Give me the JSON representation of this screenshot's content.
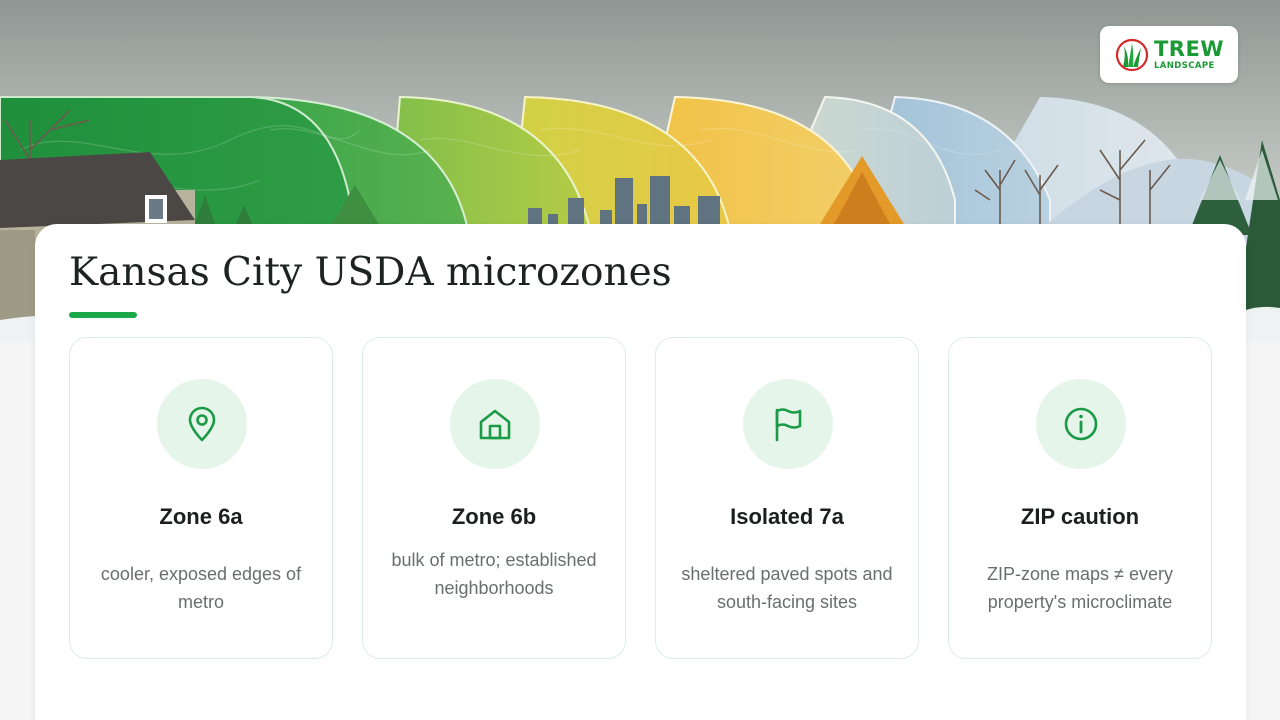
{
  "brand": {
    "name": "TREW",
    "tagline": "LANDSCAPE",
    "color": "#1a9a35"
  },
  "page": {
    "title": "Kansas City USDA microzones",
    "accent": "#1aa84a"
  },
  "zones": [
    {
      "name": "Zone 6a",
      "desc": "cooler, exposed edges of metro",
      "icon": "map-pin-icon"
    },
    {
      "name": "Zone 6b",
      "desc": "bulk of metro; established neighborhoods",
      "icon": "house-icon"
    },
    {
      "name": "Isolated 7a",
      "desc": "sheltered paved spots and south-facing sites",
      "icon": "flag-icon"
    },
    {
      "name": "ZIP caution",
      "desc": "ZIP-zone maps ≠ every property's microclimate",
      "icon": "info-icon"
    }
  ]
}
